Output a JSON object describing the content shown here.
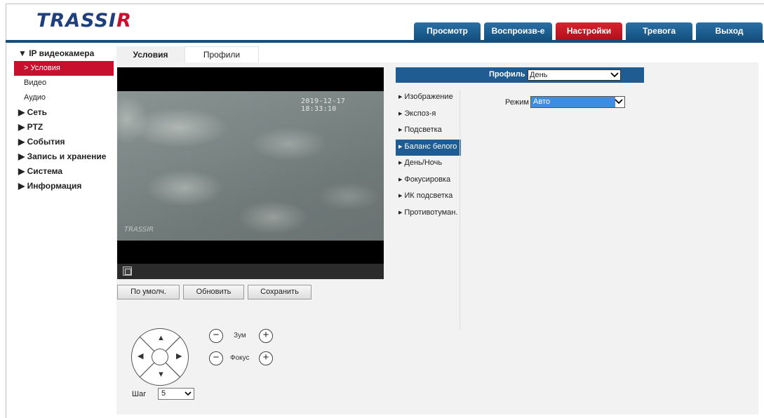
{
  "brand": {
    "logo_main": "TRASSI",
    "logo_accent": "R"
  },
  "topnav": [
    {
      "label": "Просмотр"
    },
    {
      "label": "Воспроизв-е"
    },
    {
      "label": "Настройки"
    },
    {
      "label": "Тревога"
    },
    {
      "label": "Выход"
    }
  ],
  "sidebar": {
    "ip_camera": "▼ IP видеокамера",
    "sub_conditions": "> Условия",
    "sub_video": "Видео",
    "sub_audio": "Аудио",
    "network": "▶ Сеть",
    "ptz": "▶ PTZ",
    "events": "▶ События",
    "storage": "▶ Запись и хранение",
    "system": "▶ Система",
    "info": "▶ Информация"
  },
  "subtabs": {
    "conditions": "Условия",
    "profiles": "Профили"
  },
  "video": {
    "timestamp": "2019-12-17 18:33:10",
    "watermark": "TRASSIR"
  },
  "buttons": {
    "default": "По умолч.",
    "refresh": "Обновить",
    "save": "Сохранить"
  },
  "ptz": {
    "zoom_label": "Зум",
    "focus_label": "Фокус",
    "minus": "−",
    "plus": "+",
    "arrow_up": "▲",
    "arrow_down": "▼",
    "arrow_left": "◀",
    "arrow_right": "▶",
    "step_label": "Шаг",
    "step_value": "5"
  },
  "profile": {
    "label": "Профиль",
    "value": "День"
  },
  "menu": [
    {
      "label": "Изображение"
    },
    {
      "label": "Экспоз-я"
    },
    {
      "label": "Подсветка"
    },
    {
      "label": "Баланс белого"
    },
    {
      "label": "День/Ночь"
    },
    {
      "label": "Фокусировка"
    },
    {
      "label": "ИК подсветка"
    },
    {
      "label": "Противотуман."
    }
  ],
  "mode": {
    "label": "Режим",
    "value": "Авто"
  },
  "icons": {
    "dropdown": "chevron-down-icon",
    "fullscreen": "fullscreen-icon"
  }
}
